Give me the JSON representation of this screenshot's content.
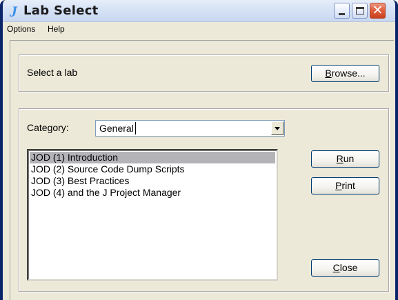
{
  "window": {
    "icon_glyph": "J",
    "title": "Lab Select",
    "controls": {
      "minimize": "minimize-icon",
      "maximize": "maximize-icon",
      "close_glyph": "✕"
    }
  },
  "menu": {
    "items": [
      "Options",
      "Help"
    ]
  },
  "top_panel": {
    "label": "Select a lab",
    "browse_prefix": "B",
    "browse_rest": "rowse..."
  },
  "category": {
    "label": "Category:",
    "selected": "General"
  },
  "labs": {
    "items": [
      "JOD (1) Introduction",
      "JOD (2) Source Code Dump Scripts",
      "JOD (3) Best Practices",
      "JOD (4) and the J Project Manager"
    ],
    "selected_index": 0
  },
  "actions": {
    "run_prefix": "R",
    "run_rest": "un",
    "print_prefix": "P",
    "print_rest": "rint",
    "close_prefix": "C",
    "close_rest": "lose"
  },
  "colors": {
    "title_bar": "#d7e3f6",
    "close_button": "#e1603f",
    "selection": "#b4b3b8",
    "window_face": "#ece9d8"
  }
}
